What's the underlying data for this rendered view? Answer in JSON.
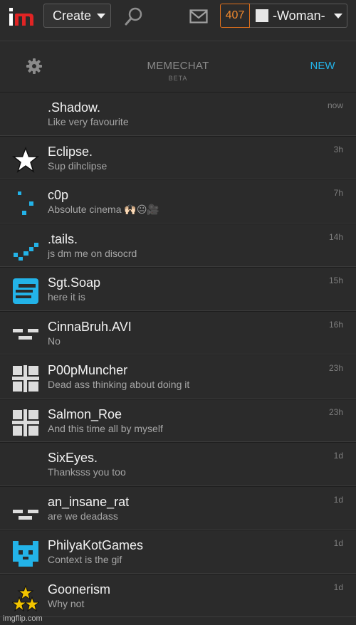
{
  "nav": {
    "logo_text": "im",
    "create_label": "Create",
    "points": "407",
    "username": "-Woman-"
  },
  "panel": {
    "title": "MEMECHAT",
    "subtitle": "BETA",
    "new_label": "NEW"
  },
  "chats": [
    {
      "name": ".Shadow.",
      "message": "Like very favourite",
      "time": "now",
      "avatar": "none"
    },
    {
      "name": "Eclipse.",
      "message": "Sup dihclipse",
      "time": "3h",
      "avatar": "star-icon"
    },
    {
      "name": "c0p",
      "message": "Absolute cinema 🙌🏻😐🎥",
      "time": "7h",
      "avatar": "dots-icon"
    },
    {
      "name": ".tails.",
      "message": "js dm me on disocrd",
      "time": "14h",
      "avatar": "checkmark-pixels-icon"
    },
    {
      "name": "Sgt.Soap",
      "message": "here it is",
      "time": "15h",
      "avatar": "s-block-icon"
    },
    {
      "name": "CinnaBruh.AVI",
      "message": "No",
      "time": "16h",
      "avatar": "dashes-icon"
    },
    {
      "name": "P00pMuncher",
      "message": "Dead ass thinking about doing it",
      "time": "23h",
      "avatar": "grid-icon"
    },
    {
      "name": "Salmon_Roe",
      "message": "And this time all by myself",
      "time": "23h",
      "avatar": "grid-icon"
    },
    {
      "name": "SixEyes.",
      "message": "Thanksss you too",
      "time": "1d",
      "avatar": "none"
    },
    {
      "name": "an_insane_rat",
      "message": "are we deadass",
      "time": "1d",
      "avatar": "dashes-icon"
    },
    {
      "name": "PhilyaKotGames",
      "message": "Context is the gif",
      "time": "1d",
      "avatar": "cat-pixel-icon"
    },
    {
      "name": "Goonerism",
      "message": "Why not",
      "time": "1d",
      "avatar": "three-stars-icon"
    }
  ],
  "watermark": "imgflip.com",
  "colors": {
    "accent": "#23b3e8",
    "points": "#f28a2e",
    "logo_red": "#e02424",
    "background": "#2b2b2b"
  }
}
